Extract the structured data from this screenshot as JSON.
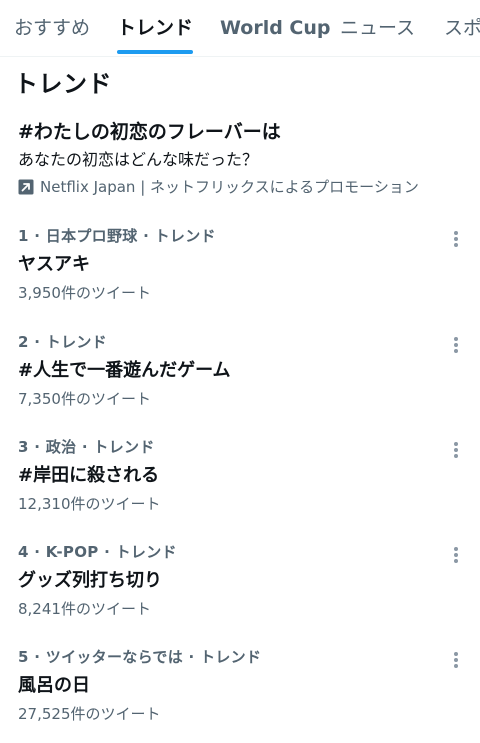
{
  "tabs": [
    "おすすめ",
    "トレンド",
    "World Cup",
    "ニュース",
    "スポ"
  ],
  "active_tab": "トレンド",
  "section_title": "トレンド",
  "promoted": {
    "title": "#わたしの初恋のフレーバーは",
    "description": "あなたの初恋はどんな味だった？",
    "promoted_by": "Netflix Japan | ネットフリックスによるプロモーション"
  },
  "trends": [
    {
      "meta": "1 · 日本プロ野球 · トレンド",
      "name": "ヤスアキ",
      "count": "3,950件のツイート"
    },
    {
      "meta": "2 · トレンド",
      "name": "#人生で一番遊んだゲーム",
      "count": "7,350件のツイート"
    },
    {
      "meta": "3 · 政治 · トレンド",
      "name": "#岸田に殺される",
      "count": "12,310件のツイート"
    },
    {
      "meta": "4 · K-POP · トレンド",
      "name": "グッズ列打ち切り",
      "count": "8,241件のツイート"
    },
    {
      "meta": "5 · ツイッターならでは · トレンド",
      "name": "風呂の日",
      "count": "27,525件のツイート"
    }
  ],
  "colors": {
    "accent": "#1d9bf0",
    "secondary_text": "#536471",
    "primary_text": "#0f1419"
  },
  "icons": {
    "promoted": "promoted-arrow-icon",
    "more": "more-options-icon"
  }
}
